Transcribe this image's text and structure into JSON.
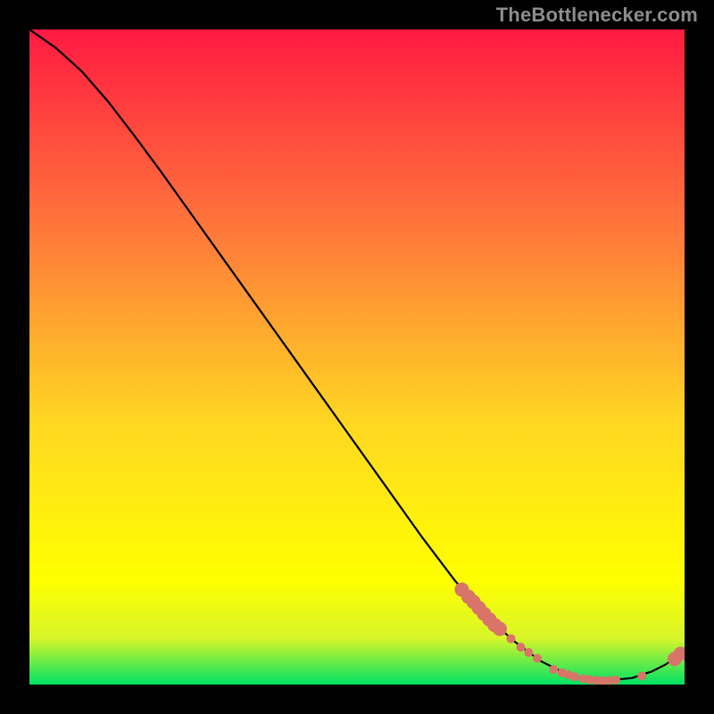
{
  "attribution": "TheBottlenecker.com",
  "colors": {
    "page_bg": "#000000",
    "attribution_text": "#8d8d8d",
    "curve_stroke": "#000000",
    "marker_fill": "#d87468",
    "gradient_top": "#ff1a42",
    "gradient_mid_upper": "#ff7c3a",
    "gradient_mid": "#ffd722",
    "gradient_mid_lower": "#ffff00",
    "gradient_bottom": "#00e264"
  },
  "chart_data": {
    "type": "line",
    "title": "",
    "xlabel": "",
    "ylabel": "",
    "xlim": [
      0,
      100
    ],
    "ylim": [
      0,
      100
    ],
    "curve": [
      {
        "x": 0,
        "y": 100
      },
      {
        "x": 4,
        "y": 97.2
      },
      {
        "x": 8,
        "y": 93.6
      },
      {
        "x": 12,
        "y": 89.0
      },
      {
        "x": 16,
        "y": 83.8
      },
      {
        "x": 20,
        "y": 78.4
      },
      {
        "x": 25,
        "y": 71.4
      },
      {
        "x": 30,
        "y": 64.4
      },
      {
        "x": 35,
        "y": 57.4
      },
      {
        "x": 40,
        "y": 50.4
      },
      {
        "x": 45,
        "y": 43.4
      },
      {
        "x": 50,
        "y": 36.4
      },
      {
        "x": 55,
        "y": 29.4
      },
      {
        "x": 60,
        "y": 22.4
      },
      {
        "x": 65,
        "y": 15.8
      },
      {
        "x": 70,
        "y": 10.2
      },
      {
        "x": 74,
        "y": 6.6
      },
      {
        "x": 78,
        "y": 3.6
      },
      {
        "x": 82,
        "y": 1.6
      },
      {
        "x": 85,
        "y": 0.8
      },
      {
        "x": 88,
        "y": 0.6
      },
      {
        "x": 92,
        "y": 1.0
      },
      {
        "x": 95,
        "y": 2.0
      },
      {
        "x": 97,
        "y": 3.0
      },
      {
        "x": 100,
        "y": 5.0
      }
    ],
    "markers": [
      {
        "x": 66,
        "y": 14.5
      },
      {
        "x": 67,
        "y": 13.4
      },
      {
        "x": 67.8,
        "y": 12.6
      },
      {
        "x": 68.6,
        "y": 11.7
      },
      {
        "x": 69.4,
        "y": 10.8
      },
      {
        "x": 70.2,
        "y": 9.95
      },
      {
        "x": 71.0,
        "y": 9.1
      },
      {
        "x": 71.8,
        "y": 8.5
      },
      {
        "x": 73.5,
        "y": 7.0
      },
      {
        "x": 75.0,
        "y": 5.7
      },
      {
        "x": 76.2,
        "y": 4.9
      },
      {
        "x": 77.5,
        "y": 4.0
      },
      {
        "x": 80,
        "y": 2.3
      },
      {
        "x": 81.3,
        "y": 1.8
      },
      {
        "x": 82.3,
        "y": 1.5
      },
      {
        "x": 83.2,
        "y": 1.2
      },
      {
        "x": 84.5,
        "y": 0.9
      },
      {
        "x": 85.5,
        "y": 0.75
      },
      {
        "x": 86.5,
        "y": 0.65
      },
      {
        "x": 87.5,
        "y": 0.6
      },
      {
        "x": 88.5,
        "y": 0.6
      },
      {
        "x": 89.5,
        "y": 0.7
      },
      {
        "x": 93.5,
        "y": 1.3
      },
      {
        "x": 98.5,
        "y": 3.9
      },
      {
        "x": 99.4,
        "y": 4.7
      }
    ],
    "marker_radius_small": 5,
    "marker_radius_large": 8
  }
}
